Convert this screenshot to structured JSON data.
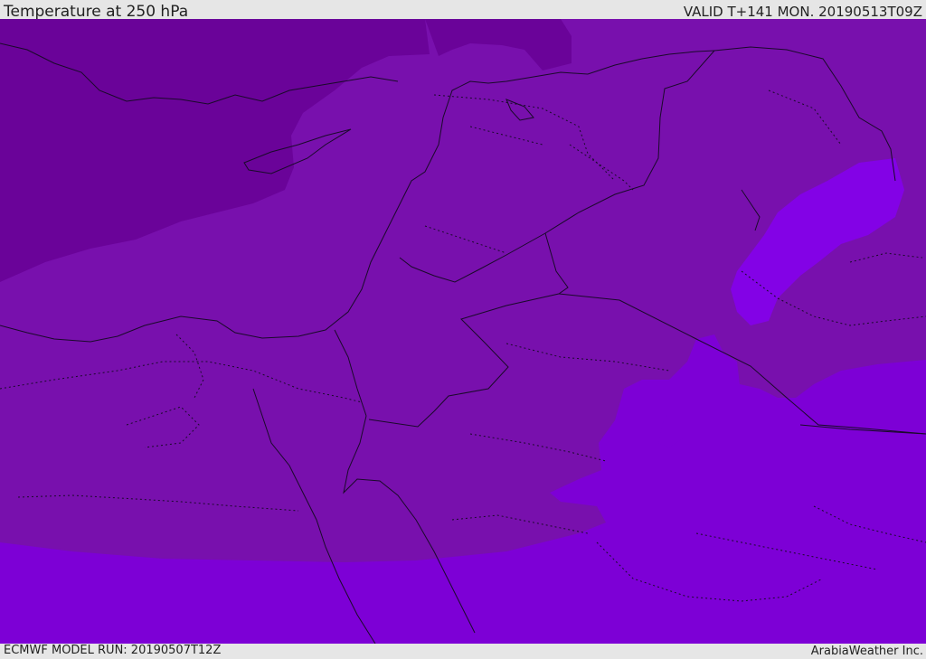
{
  "header": {
    "title": "Temperature at 250 hPa",
    "valid_time": "VALID T+141 MON. 20190513T09Z"
  },
  "footer": {
    "model_run": "ECMWF MODEL RUN: 20190507T12Z",
    "credit": "ArabiaWeather Inc."
  },
  "colors": {
    "coldest": "#6a0399",
    "cold": "#7810ad",
    "mid": "#7a0ec0",
    "warm": "#7d00d6",
    "warmest": "#8302e6",
    "boundary": "#1a0a2a",
    "frame": "#e6e6e6"
  }
}
